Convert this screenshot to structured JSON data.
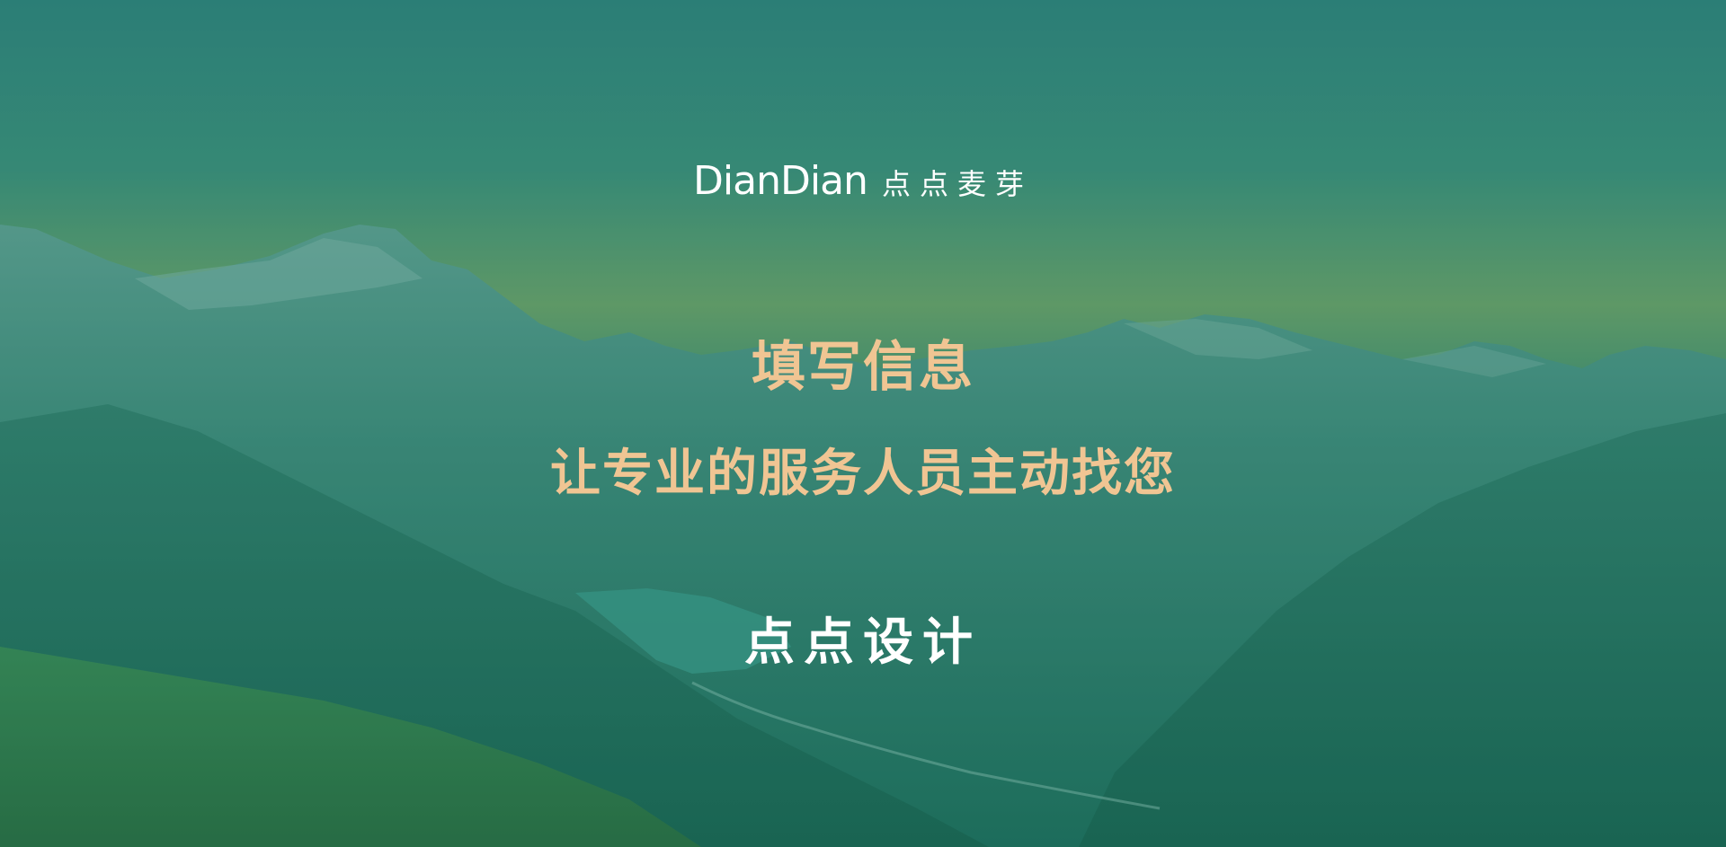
{
  "logo": {
    "wordmark": "DianDian",
    "chinese": "点点麦芽"
  },
  "hero": {
    "title": "填写信息",
    "subtitle": "让专业的服务人员主动找您",
    "brand": "点点设计"
  },
  "colors": {
    "accent_text": "#f0c593",
    "overlay": "#2a7a6a",
    "white_text": "#ffffff"
  }
}
